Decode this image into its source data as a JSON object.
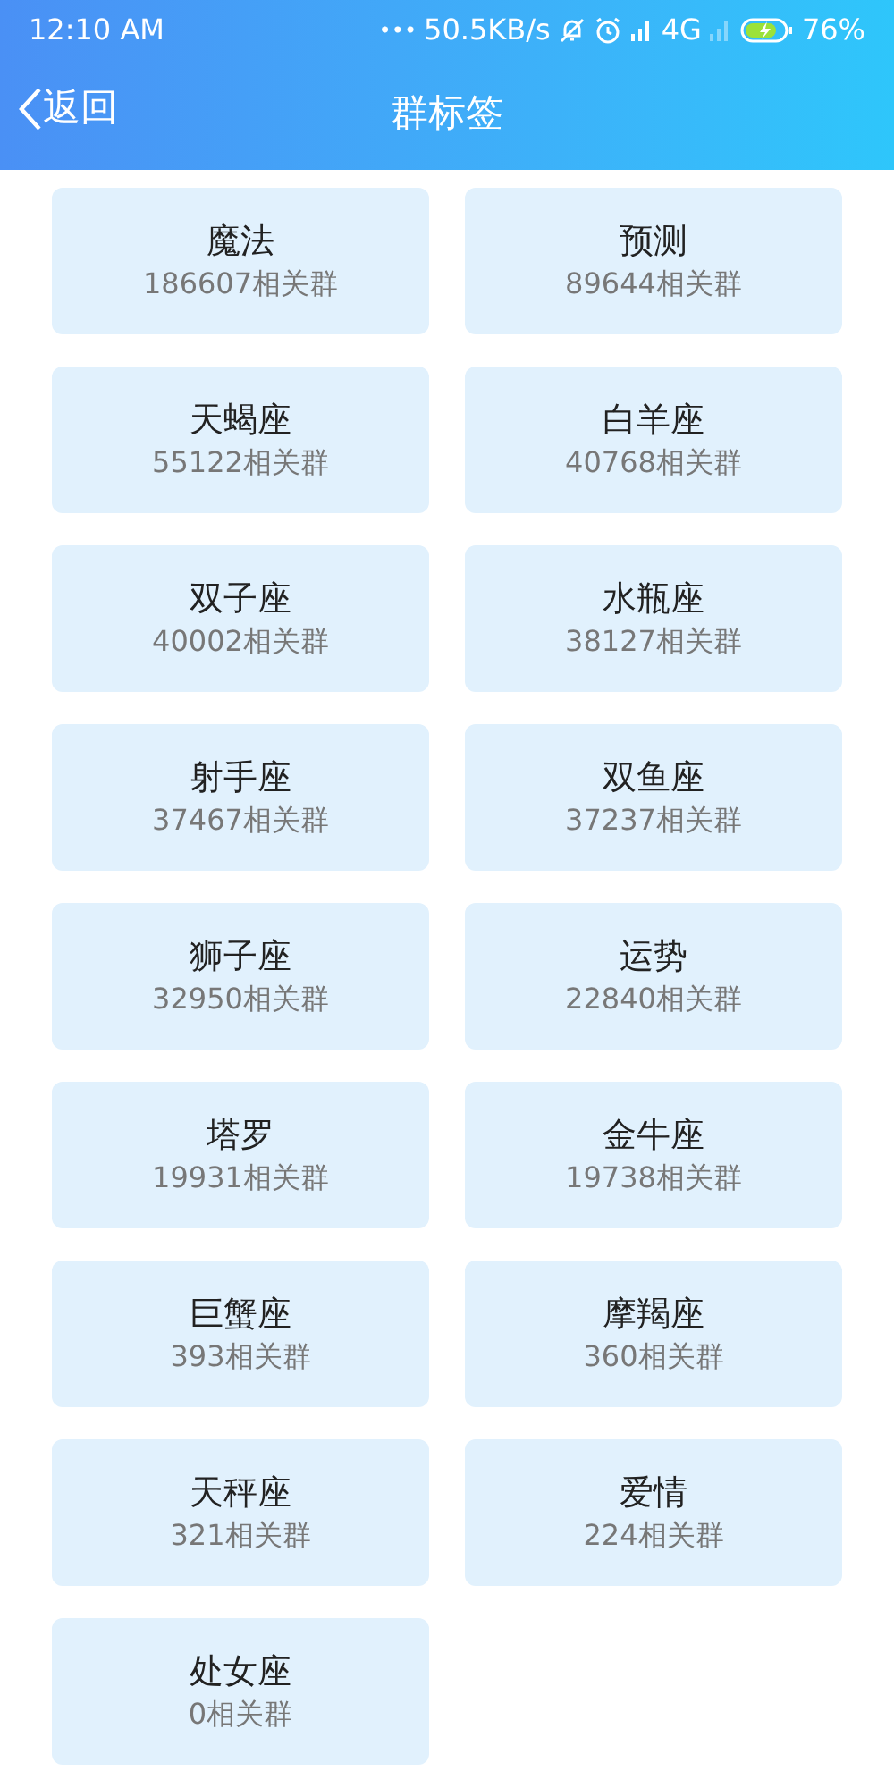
{
  "status_bar": {
    "time": "12:10 AM",
    "dots": "•••",
    "speed": "50.5KB/s",
    "network": "4G",
    "battery": "76%"
  },
  "nav": {
    "back": "返回",
    "title": "群标签"
  },
  "tags": [
    {
      "name": "魔法",
      "count": "186607相关群"
    },
    {
      "name": "预测",
      "count": "89644相关群"
    },
    {
      "name": "天蝎座",
      "count": "55122相关群"
    },
    {
      "name": "白羊座",
      "count": "40768相关群"
    },
    {
      "name": "双子座",
      "count": "40002相关群"
    },
    {
      "name": "水瓶座",
      "count": "38127相关群"
    },
    {
      "name": "射手座",
      "count": "37467相关群"
    },
    {
      "name": "双鱼座",
      "count": "37237相关群"
    },
    {
      "name": "狮子座",
      "count": "32950相关群"
    },
    {
      "name": "运势",
      "count": "22840相关群"
    },
    {
      "name": "塔罗",
      "count": "19931相关群"
    },
    {
      "name": "金牛座",
      "count": "19738相关群"
    },
    {
      "name": "巨蟹座",
      "count": "393相关群"
    },
    {
      "name": "摩羯座",
      "count": "360相关群"
    },
    {
      "name": "天秤座",
      "count": "321相关群"
    },
    {
      "name": "爱情",
      "count": "224相关群"
    },
    {
      "name": "处女座",
      "count": "0相关群"
    }
  ]
}
